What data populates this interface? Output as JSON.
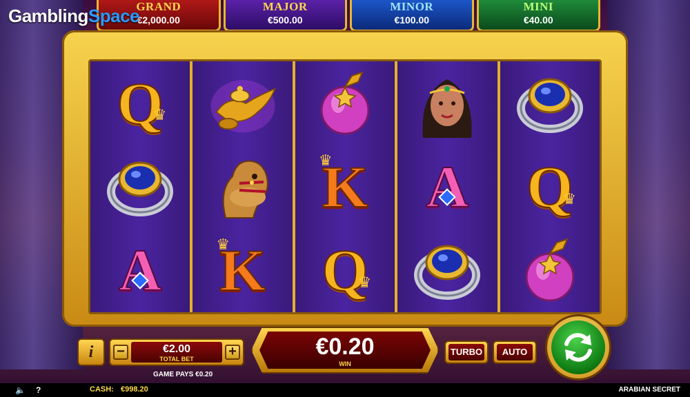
{
  "brand": {
    "part1": "Gambling",
    "part2": "Space"
  },
  "jackpots": [
    {
      "name": "GRAND",
      "value": "€2,000.00"
    },
    {
      "name": "MAJOR",
      "value": "€500.00"
    },
    {
      "name": "MINOR",
      "value": "€100.00"
    },
    {
      "name": "MINI",
      "value": "€40.00"
    }
  ],
  "reels": [
    [
      "Q",
      "ring",
      "A"
    ],
    [
      "lamp",
      "camel",
      "K"
    ],
    [
      "potion",
      "K",
      "Q"
    ],
    [
      "princess",
      "A",
      "ring"
    ],
    [
      "ring",
      "Q",
      "potion"
    ]
  ],
  "controls": {
    "info_label": "i",
    "minus_label": "−",
    "plus_label": "+",
    "bet_value": "€2.00",
    "bet_label": "TOTAL BET",
    "game_pays": "GAME PAYS €0.20",
    "win_value": "€0.20",
    "win_label": "WIN",
    "turbo_label": "TURBO",
    "auto_label": "AUTO"
  },
  "statusbar": {
    "cash_label": "CASH:",
    "cash_value": "€998.20",
    "game_title": "ARABIAN SECRET"
  },
  "colors": {
    "gold": "#e7b730",
    "reel_bg": "#4a24a0",
    "spin_green": "#1aa81e",
    "win_red": "#7a0404"
  }
}
